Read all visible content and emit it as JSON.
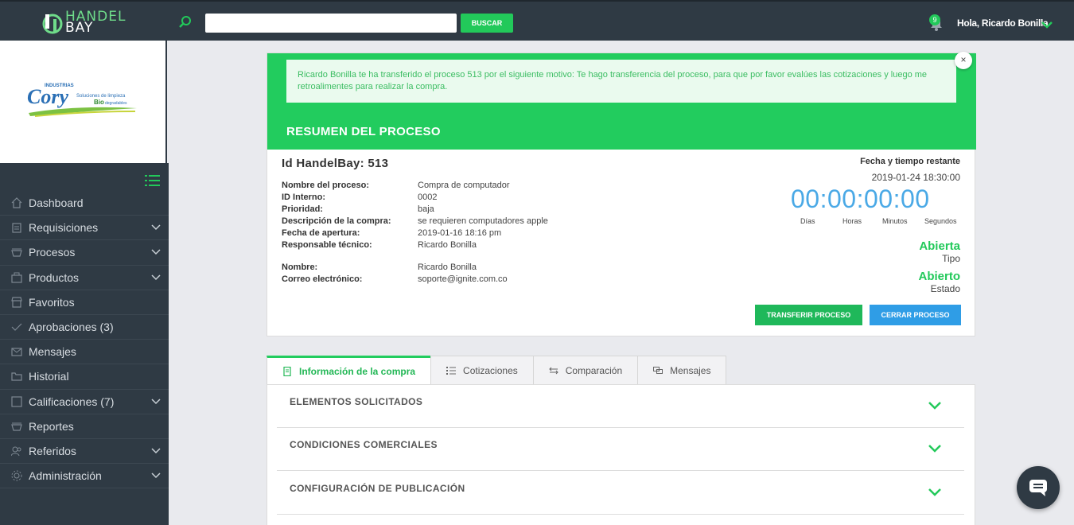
{
  "header": {
    "logo_line1": "HANDEL",
    "logo_line2": "BAY",
    "search_placeholder": "",
    "search_button": "BUSCAR",
    "notification_count": "9",
    "greeting": "Hola, Ricardo Bonilla"
  },
  "company_logo": {
    "name": "Cory",
    "tagline_top": "INDUSTRIAS",
    "tagline1": "Soluciones de limpieza",
    "tagline2a": "Bio",
    "tagline2b": "degradables"
  },
  "sidebar": {
    "items": [
      {
        "label": "Dashboard",
        "icon": "home-icon",
        "has_children": false
      },
      {
        "label": "Requisiciones",
        "icon": "clipboard-icon",
        "has_children": true
      },
      {
        "label": "Procesos",
        "icon": "basket-icon",
        "has_children": true
      },
      {
        "label": "Productos",
        "icon": "box-icon",
        "has_children": true
      },
      {
        "label": "Favoritos",
        "icon": "store-icon",
        "has_children": false
      },
      {
        "label": "Aprobaciones (3)",
        "icon": "check-icon",
        "has_children": false
      },
      {
        "label": "Mensajes",
        "icon": "envelope-icon",
        "has_children": false
      },
      {
        "label": "Historial",
        "icon": "folder-icon",
        "has_children": false
      },
      {
        "label": "Calificaciones (7)",
        "icon": "square-icon",
        "has_children": true
      },
      {
        "label": "Reportes",
        "icon": "basket-icon",
        "has_children": false
      },
      {
        "label": "Referidos",
        "icon": "users-icon",
        "has_children": true
      },
      {
        "label": "Administración",
        "icon": "gear-icon",
        "has_children": true
      }
    ]
  },
  "alert": {
    "text": "Ricardo Bonilla te ha transferido el proceso 513 por el siguiente motivo: Te hago transferencia del proceso, para que por favor evalúes las cotizaciones y luego me retroalimentes para realizar la compra.",
    "close": "×"
  },
  "summary": {
    "title": "RESUMEN DEL PROCESO",
    "id_title": "Id HandelBay: 513",
    "fields": [
      {
        "key": "Nombre del proceso:",
        "value": "Compra de computador"
      },
      {
        "key": "ID Interno:",
        "value": "0002"
      },
      {
        "key": "Prioridad:",
        "value": "baja"
      },
      {
        "key": "Descripción de la compra:",
        "value": "se requieren computadores apple"
      },
      {
        "key": "Fecha de apertura:",
        "value": "2019-01-16 18:16 pm"
      },
      {
        "key": "Responsable técnico:",
        "value": "Ricardo Bonilla"
      }
    ],
    "contact": [
      {
        "key": "Nombre:",
        "value": "Ricardo Bonilla"
      },
      {
        "key": "Correo electrónico:",
        "value": "soporte@ignite.com.co"
      }
    ],
    "remaining_label": "Fecha y tiempo restante",
    "remaining_date": "2019-01-24 18:30:00",
    "countdown": "00:00:00:00",
    "countdown_labels": [
      "Días",
      "Horas",
      "Minutos",
      "Segundos"
    ],
    "tipo_value": "Abierta",
    "tipo_label": "Tipo",
    "estado_value": "Abierto",
    "estado_label": "Estado",
    "transfer_button": "TRANSFERIR PROCESO",
    "close_button": "CERRAR PROCESO"
  },
  "tabs": [
    {
      "label": "Información de la compra",
      "active": true
    },
    {
      "label": "Cotizaciones",
      "active": false
    },
    {
      "label": "Comparación",
      "active": false
    },
    {
      "label": "Mensajes",
      "active": false
    }
  ],
  "accordion": [
    {
      "title": "ELEMENTOS SOLICITADOS"
    },
    {
      "title": "CONDICIONES COMERCIALES"
    },
    {
      "title": "CONFIGURACIÓN DE PUBLICACIÓN"
    }
  ],
  "colors": {
    "accent": "#22cc5e",
    "sidebar_bg": "#2f3a44",
    "countdown": "#4aa9e6",
    "close_button": "#2f9de6"
  }
}
